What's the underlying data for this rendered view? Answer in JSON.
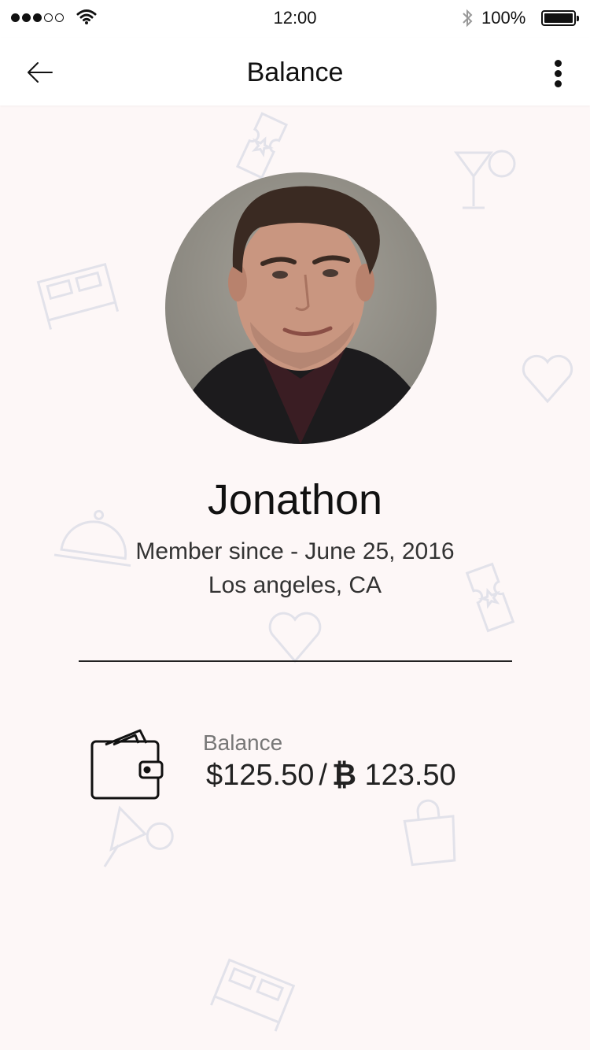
{
  "status_bar": {
    "time": "12:00",
    "battery": "100%",
    "signal_bars_filled": 3,
    "signal_bars_total": 5
  },
  "nav": {
    "title": "Balance",
    "back_icon": "arrow-left-icon",
    "more_icon": "more-vertical-icon"
  },
  "profile": {
    "name": "Jonathon",
    "member_since": "Member since - June 25, 2016",
    "location": "Los angeles, CA"
  },
  "balance": {
    "label": "Balance",
    "usd": "$125.50",
    "separator": "/",
    "btc_symbol": "₿",
    "btc": "123.50",
    "icon": "wallet-icon"
  },
  "colors": {
    "background": "#fdf7f7",
    "bar": "#ffffff",
    "doodle": "#e2e2ea"
  }
}
